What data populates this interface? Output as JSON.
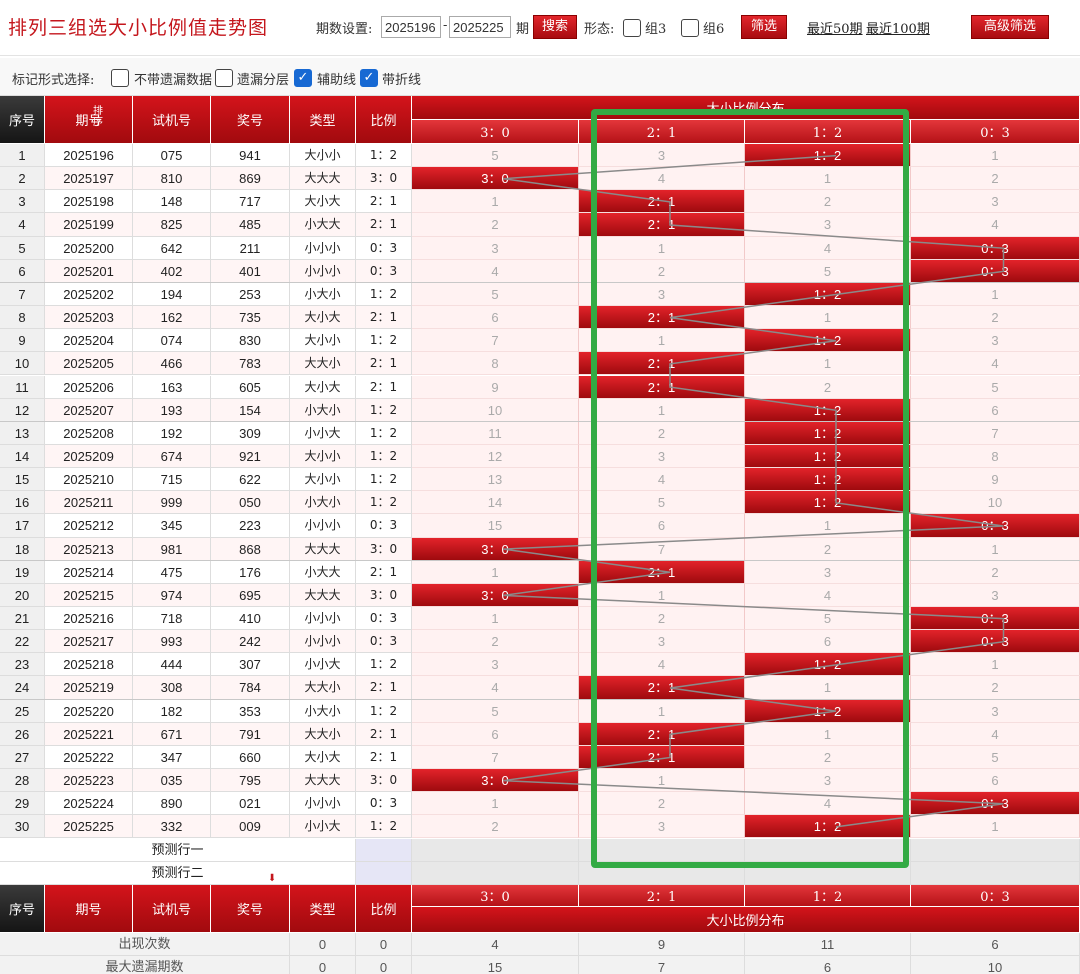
{
  "header": {
    "title": "排列三组选大小比例值走势图",
    "period_label": "期数设置:",
    "period_from": "2025196",
    "dash": "-",
    "period_to": "2025225",
    "period_unit": "期",
    "search_label": "搜索",
    "form_label": "形态:",
    "group3_label": "组3",
    "group6_label": "组6",
    "filter_label": "筛选",
    "recent50_label": "最近50期",
    "recent100_label": "最近100期",
    "advanced_label": "高级筛选"
  },
  "markbar": {
    "label": "标记形式选择:",
    "opt1": "不带遗漏数据",
    "opt2": "遗漏分层",
    "opt3": "辅助线",
    "opt4": "带折线",
    "checked": [
      false,
      false,
      true,
      true
    ],
    "check_glyph": "✓"
  },
  "columns": {
    "seq": "序号",
    "period": "期号",
    "sort": "排序",
    "trial": "试机号",
    "prize": "奖号",
    "type": "类型",
    "ratio": "比例",
    "group": "大小比例分布",
    "ratios": [
      "3：0",
      "2：1",
      "1：2",
      "0：3"
    ]
  },
  "rows": [
    {
      "seq": "1",
      "period": "2025196",
      "trial": "075",
      "prize": "941",
      "type": "大小小",
      "ratio": "1：2",
      "hit": 2,
      "m": [
        "5",
        "3",
        "1：2",
        "1"
      ]
    },
    {
      "seq": "2",
      "period": "2025197",
      "trial": "810",
      "prize": "869",
      "type": "大大大",
      "ratio": "3：0",
      "hit": 0,
      "m": [
        "3：0",
        "4",
        "1",
        "2"
      ]
    },
    {
      "seq": "3",
      "period": "2025198",
      "trial": "148",
      "prize": "717",
      "type": "大小大",
      "ratio": "2：1",
      "hit": 1,
      "m": [
        "1",
        "2：1",
        "2",
        "3"
      ]
    },
    {
      "seq": "4",
      "period": "2025199",
      "trial": "825",
      "prize": "485",
      "type": "小大大",
      "ratio": "2：1",
      "hit": 1,
      "m": [
        "2",
        "2：1",
        "3",
        "4"
      ]
    },
    {
      "seq": "5",
      "period": "2025200",
      "trial": "642",
      "prize": "211",
      "type": "小小小",
      "ratio": "0：3",
      "hit": 3,
      "m": [
        "3",
        "1",
        "4",
        "0：3"
      ]
    },
    {
      "seq": "6",
      "period": "2025201",
      "trial": "402",
      "prize": "401",
      "type": "小小小",
      "ratio": "0：3",
      "hit": 3,
      "m": [
        "4",
        "2",
        "5",
        "0：3"
      ]
    },
    {
      "seq": "7",
      "period": "2025202",
      "trial": "194",
      "prize": "253",
      "type": "小大小",
      "ratio": "1：2",
      "hit": 2,
      "m": [
        "5",
        "3",
        "1：2",
        "1"
      ]
    },
    {
      "seq": "8",
      "period": "2025203",
      "trial": "162",
      "prize": "735",
      "type": "大小大",
      "ratio": "2：1",
      "hit": 1,
      "m": [
        "6",
        "2：1",
        "1",
        "2"
      ]
    },
    {
      "seq": "9",
      "period": "2025204",
      "trial": "074",
      "prize": "830",
      "type": "大小小",
      "ratio": "1：2",
      "hit": 2,
      "m": [
        "7",
        "1",
        "1：2",
        "3"
      ]
    },
    {
      "seq": "10",
      "period": "2025205",
      "trial": "466",
      "prize": "783",
      "type": "大大小",
      "ratio": "2：1",
      "hit": 1,
      "m": [
        "8",
        "2：1",
        "1",
        "4"
      ]
    },
    {
      "seq": "11",
      "period": "2025206",
      "trial": "163",
      "prize": "605",
      "type": "大小大",
      "ratio": "2：1",
      "hit": 1,
      "m": [
        "9",
        "2：1",
        "2",
        "5"
      ]
    },
    {
      "seq": "12",
      "period": "2025207",
      "trial": "193",
      "prize": "154",
      "type": "小大小",
      "ratio": "1：2",
      "hit": 2,
      "m": [
        "10",
        "1",
        "1：2",
        "6"
      ]
    },
    {
      "seq": "13",
      "period": "2025208",
      "trial": "192",
      "prize": "309",
      "type": "小小大",
      "ratio": "1：2",
      "hit": 2,
      "m": [
        "11",
        "2",
        "1：2",
        "7"
      ]
    },
    {
      "seq": "14",
      "period": "2025209",
      "trial": "674",
      "prize": "921",
      "type": "大小小",
      "ratio": "1：2",
      "hit": 2,
      "m": [
        "12",
        "3",
        "1：2",
        "8"
      ]
    },
    {
      "seq": "15",
      "period": "2025210",
      "trial": "715",
      "prize": "622",
      "type": "大小小",
      "ratio": "1：2",
      "hit": 2,
      "m": [
        "13",
        "4",
        "1：2",
        "9"
      ]
    },
    {
      "seq": "16",
      "period": "2025211",
      "trial": "999",
      "prize": "050",
      "type": "小大小",
      "ratio": "1：2",
      "hit": 2,
      "m": [
        "14",
        "5",
        "1：2",
        "10"
      ]
    },
    {
      "seq": "17",
      "period": "2025212",
      "trial": "345",
      "prize": "223",
      "type": "小小小",
      "ratio": "0：3",
      "hit": 3,
      "m": [
        "15",
        "6",
        "1",
        "0：3"
      ]
    },
    {
      "seq": "18",
      "period": "2025213",
      "trial": "981",
      "prize": "868",
      "type": "大大大",
      "ratio": "3：0",
      "hit": 0,
      "m": [
        "3：0",
        "7",
        "2",
        "1"
      ]
    },
    {
      "seq": "19",
      "period": "2025214",
      "trial": "475",
      "prize": "176",
      "type": "小大大",
      "ratio": "2：1",
      "hit": 1,
      "m": [
        "1",
        "2：1",
        "3",
        "2"
      ]
    },
    {
      "seq": "20",
      "period": "2025215",
      "trial": "974",
      "prize": "695",
      "type": "大大大",
      "ratio": "3：0",
      "hit": 0,
      "m": [
        "3：0",
        "1",
        "4",
        "3"
      ]
    },
    {
      "seq": "21",
      "period": "2025216",
      "trial": "718",
      "prize": "410",
      "type": "小小小",
      "ratio": "0：3",
      "hit": 3,
      "m": [
        "1",
        "2",
        "5",
        "0：3"
      ]
    },
    {
      "seq": "22",
      "period": "2025217",
      "trial": "993",
      "prize": "242",
      "type": "小小小",
      "ratio": "0：3",
      "hit": 3,
      "m": [
        "2",
        "3",
        "6",
        "0：3"
      ]
    },
    {
      "seq": "23",
      "period": "2025218",
      "trial": "444",
      "prize": "307",
      "type": "小小大",
      "ratio": "1：2",
      "hit": 2,
      "m": [
        "3",
        "4",
        "1：2",
        "1"
      ]
    },
    {
      "seq": "24",
      "period": "2025219",
      "trial": "308",
      "prize": "784",
      "type": "大大小",
      "ratio": "2：1",
      "hit": 1,
      "m": [
        "4",
        "2：1",
        "1",
        "2"
      ]
    },
    {
      "seq": "25",
      "period": "2025220",
      "trial": "182",
      "prize": "353",
      "type": "小大小",
      "ratio": "1：2",
      "hit": 2,
      "m": [
        "5",
        "1",
        "1：2",
        "3"
      ]
    },
    {
      "seq": "26",
      "period": "2025221",
      "trial": "671",
      "prize": "791",
      "type": "大大小",
      "ratio": "2：1",
      "hit": 1,
      "m": [
        "6",
        "2：1",
        "1",
        "4"
      ]
    },
    {
      "seq": "27",
      "period": "2025222",
      "trial": "347",
      "prize": "660",
      "type": "大小大",
      "ratio": "2：1",
      "hit": 1,
      "m": [
        "7",
        "2：1",
        "2",
        "5"
      ]
    },
    {
      "seq": "28",
      "period": "2025223",
      "trial": "035",
      "prize": "795",
      "type": "大大大",
      "ratio": "3：0",
      "hit": 0,
      "m": [
        "3：0",
        "1",
        "3",
        "6"
      ]
    },
    {
      "seq": "29",
      "period": "2025224",
      "trial": "890",
      "prize": "021",
      "type": "小小小",
      "ratio": "0：3",
      "hit": 3,
      "m": [
        "1",
        "2",
        "4",
        "0：3"
      ]
    },
    {
      "seq": "30",
      "period": "2025225",
      "trial": "332",
      "prize": "009",
      "type": "小小大",
      "ratio": "1：2",
      "hit": 2,
      "m": [
        "2",
        "3",
        "1：2",
        "1"
      ]
    }
  ],
  "predict": [
    "预测行一",
    "预测行二"
  ],
  "stats": [
    {
      "label": "出现次数",
      "type": "0",
      "ratio": "0",
      "v": [
        "4",
        "9",
        "11",
        "6"
      ]
    },
    {
      "label": "最大遗漏期数",
      "type": "0",
      "ratio": "0",
      "v": [
        "15",
        "7",
        "6",
        "10"
      ]
    }
  ]
}
